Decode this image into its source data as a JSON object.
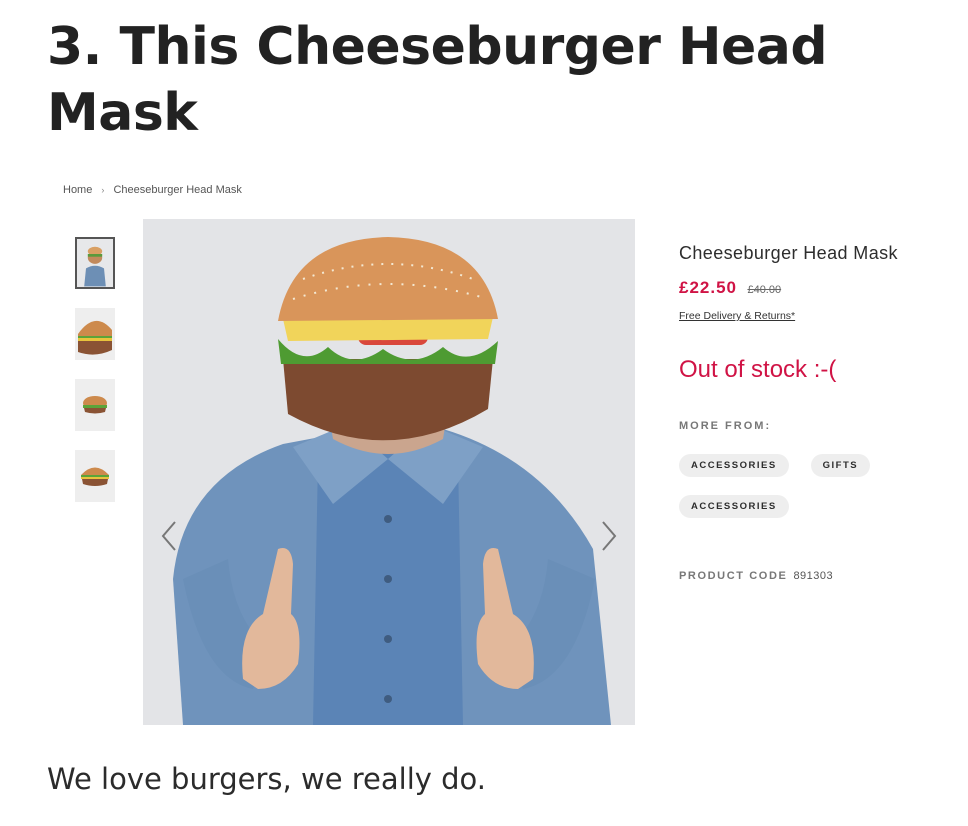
{
  "article": {
    "title": "3. This Cheeseburger Head Mask",
    "caption": "We love burgers, we really do."
  },
  "breadcrumb": {
    "home": "Home",
    "separator": "›",
    "current": "Cheeseburger Head Mask"
  },
  "product": {
    "name": "Cheeseburger Head Mask",
    "price": "£22.50",
    "price_was": "£40.00",
    "delivery_link": "Free Delivery & Returns*",
    "stock_status": "Out of stock :-(",
    "more_from_label": "MORE FROM:",
    "tags": [
      "ACCESSORIES",
      "GIFTS",
      "ACCESSORIES"
    ],
    "product_code_label": "PRODUCT CODE",
    "product_code": "891303"
  },
  "gallery": {
    "thumbnail_count": 4,
    "active_thumbnail": 1
  },
  "colors": {
    "accent": "#d01345",
    "title": "#222222"
  }
}
